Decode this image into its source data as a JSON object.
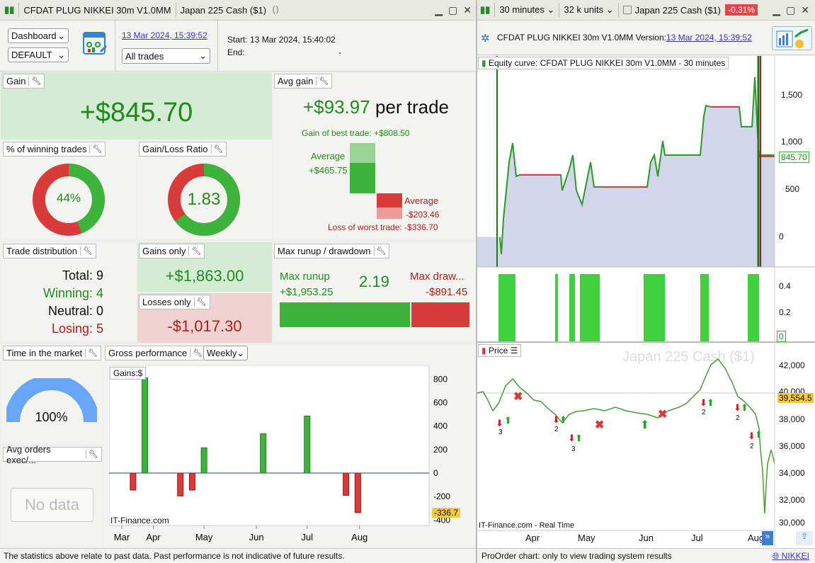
{
  "left_window": {
    "title": "CFDAT PLUG NIKKEI 30m V1.0MM",
    "instrument": "Japan 225 Cash ($1)"
  },
  "controls": {
    "view_select": "Dashboard",
    "config_select": "DEFAULT",
    "date_link": "13 Mar 2024, 15:39:52",
    "trades_select": "All trades",
    "start_label": "Start:",
    "start_value": "13 Mar 2024, 15:40:02",
    "end_label": "End:",
    "end_value": "-"
  },
  "gain": {
    "label": "Gain",
    "value": "+$845.70"
  },
  "avg_gain": {
    "label": "Avg gain",
    "value": "+$93.97",
    "suffix": "per trade",
    "best_trade": "Gain of best trade: +$808.50",
    "avg_win_label": "Average",
    "avg_win_value": "+$465.75",
    "avg_loss_label": "Average",
    "avg_loss_value": "-$203.46",
    "worst_trade": "Loss of worst trade: -$336.70"
  },
  "winning_pct": {
    "label": "% of winning trades",
    "value": "44%",
    "fraction": 0.44
  },
  "gain_loss_ratio": {
    "label": "Gain/Loss Ratio",
    "value": "1.83",
    "fraction": 0.647
  },
  "trade_distribution": {
    "label": "Trade distribution",
    "total": "Total: 9",
    "winning": "Winning: 4",
    "neutral": "Neutral: 0",
    "losing": "Losing: 5"
  },
  "gains_only": {
    "label": "Gains only",
    "value": "+$1,863.00"
  },
  "losses_only": {
    "label": "Losses only",
    "value": "-$1,017.30"
  },
  "runup": {
    "label": "Max runup / drawdown",
    "runup_label": "Max runup",
    "runup_value": "+$1,953.25",
    "ratio": "2.19",
    "drawdown_label": "Max draw...",
    "drawdown_value": "-$891.45",
    "runup_fraction": 0.687
  },
  "time_in_market": {
    "label": "Time in the market",
    "value": "100%",
    "fraction": 1.0
  },
  "avg_orders": {
    "label": "Avg orders exec/...",
    "no_data": "No data"
  },
  "gross": {
    "label": "Gross performance",
    "period": "Weekly",
    "gains_label": "Gains:$",
    "watermark": "IT-Finance.com",
    "last_value": "-336.7"
  },
  "chart_data": {
    "type": "bar",
    "title": "Gains:$",
    "categories": [
      "Mar",
      "Apr",
      "May",
      "Jun",
      "Jul",
      "Aug"
    ],
    "x_positions": [
      "Mar 20",
      "Mar 27",
      "Apr 17",
      "Apr 24",
      "May 1",
      "Jun 5",
      "Jul 1",
      "Jul 24",
      "Jul 31"
    ],
    "values": [
      -145,
      810,
      -195,
      -145,
      215,
      335,
      485,
      -190,
      -336.7
    ],
    "yticks": [
      800,
      600,
      400,
      200,
      0,
      -200,
      -400
    ],
    "ylim": [
      -410,
      880
    ]
  },
  "right_window": {
    "timeframe": "30 minutes",
    "units": "32 k units",
    "instrument": "Japan 225 Cash ($1)",
    "change": "-0.31%",
    "system": "CFDAT PLUG NIKKEI 30m V1.0MM",
    "version_label": "Version:",
    "version_date": "13 Mar 2024, 15:39:52"
  },
  "equity": {
    "label": "Equity curve: CFDAT PLUG NIKKEI 30m V1.0MM - 30 minutes",
    "last": "845.70",
    "yticks": [
      "1,500",
      "1,000",
      "500",
      "0"
    ],
    "pos_ticks": [
      "0.4",
      "0.2",
      "0"
    ],
    "pos_last": "0"
  },
  "price": {
    "label": "Price",
    "watermark": "Japan 225 Cash ($1)",
    "last": "39,554.5",
    "yticks": [
      "42,000",
      "40,000",
      "38,000",
      "36,000",
      "34,000",
      "32,000",
      "30,000"
    ],
    "xticks": [
      "Apr",
      "May",
      "Jun",
      "Jul",
      "Aug"
    ],
    "footer": "IT-Finance.com - Real Time",
    "markers": [
      "3",
      "2",
      "3",
      "2",
      "2",
      "2"
    ]
  },
  "footer": {
    "left": "The statistics above relate to past data. Past performance is not indicative of future results.",
    "right": "ProOrder chart: only to view trading system results",
    "nikkei": "NIKKEI"
  },
  "colors": {
    "green": "#3cb43c",
    "red": "#d93a3a",
    "blue_gauge": "#6aa6f8"
  }
}
